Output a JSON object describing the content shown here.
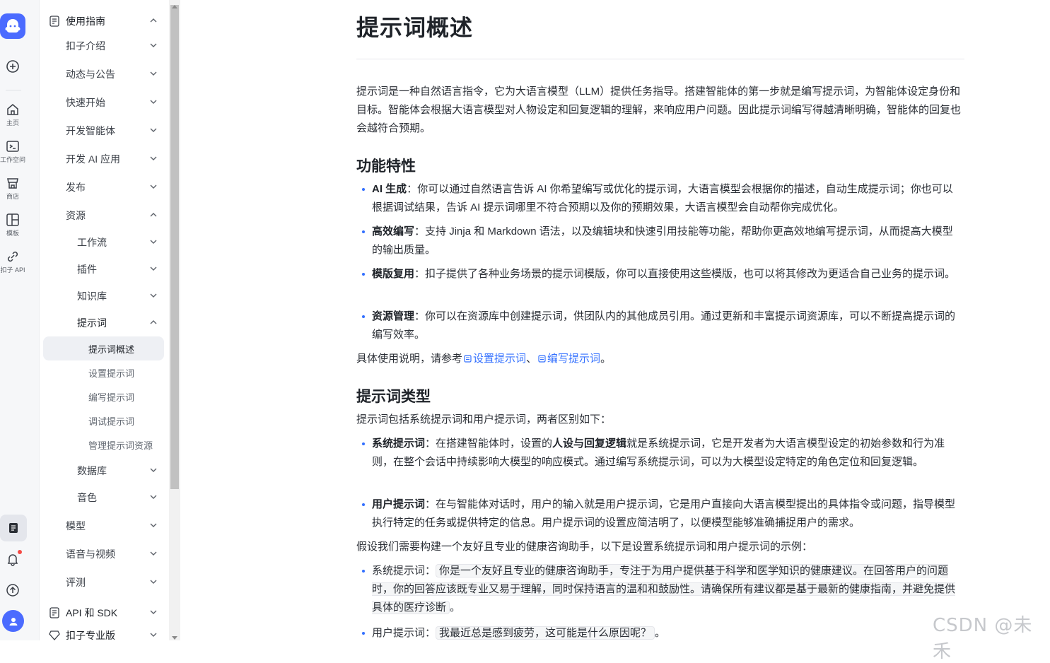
{
  "rail": {
    "items": [
      {
        "label": "主页",
        "icon": "home-icon"
      },
      {
        "label": "工作空间",
        "icon": "terminal-icon"
      },
      {
        "label": "商店",
        "icon": "store-icon"
      },
      {
        "label": "模板",
        "icon": "template-icon"
      },
      {
        "label": "扣子 API",
        "icon": "api-link-icon"
      }
    ]
  },
  "sidebar": {
    "section_top": "使用指南",
    "items": [
      "扣子介绍",
      "动态与公告",
      "快速开始",
      "开发智能体",
      "开发 AI 应用",
      "发布",
      "资源"
    ],
    "resources": [
      "工作流",
      "插件",
      "知识库",
      "提示词"
    ],
    "prompt_children": [
      "提示词概述",
      "设置提示词",
      "编写提示词",
      "调试提示词",
      "管理提示词资源"
    ],
    "resources_after": [
      "数据库",
      "音色"
    ],
    "items_after": [
      "模型",
      "语音与视频",
      "评测"
    ],
    "section_api": "API 和 SDK",
    "section_pro": "扣子专业版"
  },
  "article": {
    "title": "提示词概述",
    "intro": "提示词是一种自然语言指令，它为大语言模型（LLM）提供任务指导。搭建智能体的第一步就是编写提示词，为智能体设定身份和目标。智能体会根据大语言模型对人物设定和回复逻辑的理解，来响应用户问题。因此提示词编写得越清晰明确，智能体的回复也会越符合预期。",
    "h_features": "功能特性",
    "features": [
      {
        "term": "AI 生成",
        "sep": "：",
        "text": "你可以通过自然语言告诉 AI 你希望编写或优化的提示词，大语言模型会根据你的描述，自动生成提示词；你也可以根据调试结果，告诉 AI 提示词哪里不符合预期以及你的预期效果，大语言模型会自动帮你完成优化。"
      },
      {
        "term": "高效编写",
        "sep": "：",
        "text": "支持 Jinja 和 Markdown 语法，以及编辑块和快速引用技能等功能，帮助你更高效地编写提示词，从而提高大模型的输出质量。"
      },
      {
        "term": "模版复用",
        "sep": "：",
        "text": "扣子提供了各种业务场景的提示词模版，你可以直接使用这些模版，也可以将其修改为更适合自己业务的提示词。"
      },
      {
        "term": "资源管理",
        "sep": "：",
        "text": "你可以在资源库中创建提示词，供团队内的其他成员引用。通过更新和丰富提示词资源库，可以不断提高提示词的编写效率。"
      }
    ],
    "refer_prefix": "具体使用说明，请参考",
    "refer_link1": "设置提示词",
    "refer_mid": "、",
    "refer_link2": "编写提示词",
    "refer_suffix": "。",
    "h_types": "提示词类型",
    "types_intro": "提示词包括系统提示词和用户提示词，两者区别如下：",
    "type_system": {
      "term": "系统提示词",
      "sep": "：",
      "text_a": "在搭建智能体时，设置的",
      "bold": "人设与回复逻辑",
      "text_b": "就是系统提示词，它是开发者为大语言模型设定的初始参数和行为准则，在整个会话中持续影响大模型的响应模式。通过编写系统提示词，可以为大模型设定特定的角色定位和回复逻辑。"
    },
    "type_user": {
      "term": "用户提示词",
      "sep": "：",
      "text": "在与智能体对话时，用户的输入就是用户提示词，它是用户直接向大语言模型提出的具体指令或问题，指导模型执行特定的任务或提供特定的信息。用户提示词的设置应简洁明了，以便模型能够准确捕捉用户的需求。"
    },
    "example_intro": "假设我们需要构建一个友好且专业的健康咨询助手，以下是设置系统提示词和用户提示词的示例：",
    "example_system_label": "系统提示词：",
    "example_system_code": "你是一个友好且专业的健康咨询助手，专注于为用户提供基于科学和医学知识的健康建议。在回答用户的问题时，你的回答应该既专业又易于理解，同时保持语言的温和和鼓励性。请确保所有建议都是基于最新的健康指南，并避免提供具体的医疗诊断",
    "example_user_label": "用户提示词：",
    "example_user_code": "我最近总是感到疲劳，这可能是什么原因呢？",
    "period": "。"
  },
  "watermark": "CSDN @未禾",
  "colors": {
    "accent": "#3370ff",
    "brand": "#4b6bff",
    "notify": "#f54a45"
  }
}
